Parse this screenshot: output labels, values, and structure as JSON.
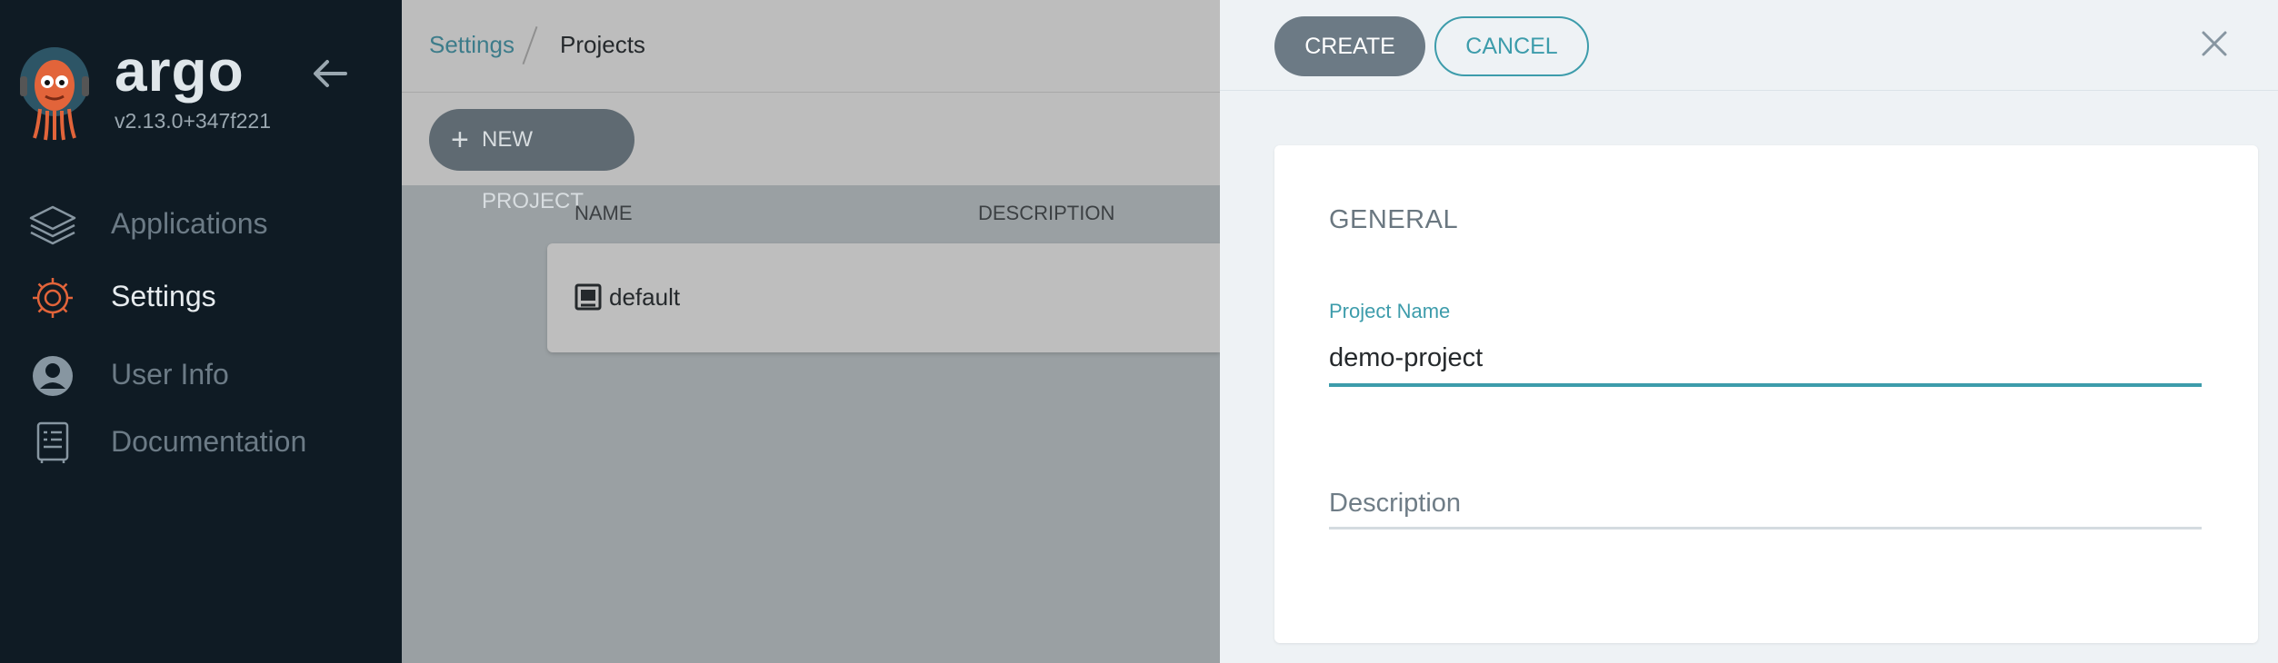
{
  "sidebar": {
    "brand": "argo",
    "version": "v2.13.0+347f221",
    "items": [
      {
        "label": "Applications",
        "icon": "layers-icon"
      },
      {
        "label": "Settings",
        "icon": "gear-icon",
        "active": true
      },
      {
        "label": "User Info",
        "icon": "user-icon"
      },
      {
        "label": "Documentation",
        "icon": "book-icon"
      }
    ]
  },
  "breadcrumb": {
    "parent": "Settings",
    "current": "Projects"
  },
  "toolbar": {
    "new_project_label": "NEW PROJECT"
  },
  "table": {
    "columns": [
      "NAME",
      "DESCRIPTION"
    ],
    "rows": [
      {
        "name": "default",
        "description": ""
      }
    ]
  },
  "panel": {
    "create_label": "CREATE",
    "cancel_label": "CANCEL",
    "section_title": "GENERAL",
    "project_name_label": "Project Name",
    "project_name_value": "demo-project",
    "description_placeholder": "Description"
  },
  "colors": {
    "sidebar_bg": "#0f1b24",
    "accent_teal": "#3d9cab",
    "settings_icon_orange": "#e2643a"
  }
}
